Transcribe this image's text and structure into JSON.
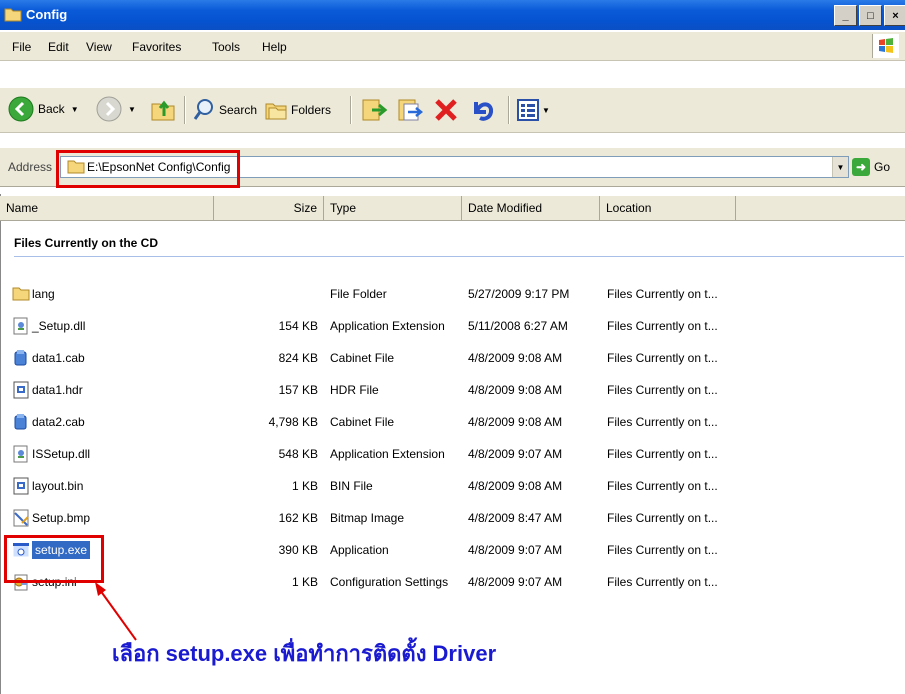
{
  "window": {
    "title": "Config",
    "buttons": [
      "minimize",
      "maximize",
      "close"
    ]
  },
  "menu": {
    "items": [
      "File",
      "Edit",
      "View",
      "Favorites",
      "Tools",
      "Help"
    ]
  },
  "toolbar": {
    "back_label": "Back",
    "search_label": "Search",
    "folders_label": "Folders"
  },
  "address": {
    "label": "Address",
    "value": "E:\\EpsonNet Config\\Config",
    "go_label": "Go"
  },
  "columns": [
    "Name",
    "Size",
    "Type",
    "Date Modified",
    "Location"
  ],
  "group_label": "Files Currently on the CD",
  "files": [
    {
      "name": "lang",
      "size": "",
      "type": "File Folder",
      "date": "5/27/2009 9:17 PM",
      "location": "Files Currently on t...",
      "icon": "folder-icon"
    },
    {
      "name": "_Setup.dll",
      "size": "154 KB",
      "type": "Application Extension",
      "date": "5/11/2008 6:27 AM",
      "location": "Files Currently on t...",
      "icon": "dll-icon"
    },
    {
      "name": "data1.cab",
      "size": "824 KB",
      "type": "Cabinet File",
      "date": "4/8/2009 9:08 AM",
      "location": "Files Currently on t...",
      "icon": "cab-icon"
    },
    {
      "name": "data1.hdr",
      "size": "157 KB",
      "type": "HDR File",
      "date": "4/8/2009 9:08 AM",
      "location": "Files Currently on t...",
      "icon": "generic-file-icon"
    },
    {
      "name": "data2.cab",
      "size": "4,798 KB",
      "type": "Cabinet File",
      "date": "4/8/2009 9:08 AM",
      "location": "Files Currently on t...",
      "icon": "cab-icon"
    },
    {
      "name": "ISSetup.dll",
      "size": "548 KB",
      "type": "Application Extension",
      "date": "4/8/2009 9:07 AM",
      "location": "Files Currently on t...",
      "icon": "dll-icon"
    },
    {
      "name": "layout.bin",
      "size": "1 KB",
      "type": "BIN File",
      "date": "4/8/2009 9:08 AM",
      "location": "Files Currently on t...",
      "icon": "generic-file-icon"
    },
    {
      "name": "Setup.bmp",
      "size": "162 KB",
      "type": "Bitmap Image",
      "date": "4/8/2009 8:47 AM",
      "location": "Files Currently on t...",
      "icon": "bitmap-icon"
    },
    {
      "name": "setup.exe",
      "size": "390 KB",
      "type": "Application",
      "date": "4/8/2009 9:07 AM",
      "location": "Files Currently on t...",
      "icon": "exe-icon",
      "selected": true
    },
    {
      "name": "setup.ini",
      "size": "1 KB",
      "type": "Configuration Settings",
      "date": "4/8/2009 9:07 AM",
      "location": "Files Currently on t...",
      "icon": "ini-icon"
    }
  ],
  "annotation": "เลือก setup.exe เพื่อทำการติดตั้ง Driver",
  "colors": {
    "titlebar": "#0a5ad8",
    "selection": "#316ac5",
    "highlight_box": "#e00000",
    "annotation": "#1a1ad0"
  }
}
